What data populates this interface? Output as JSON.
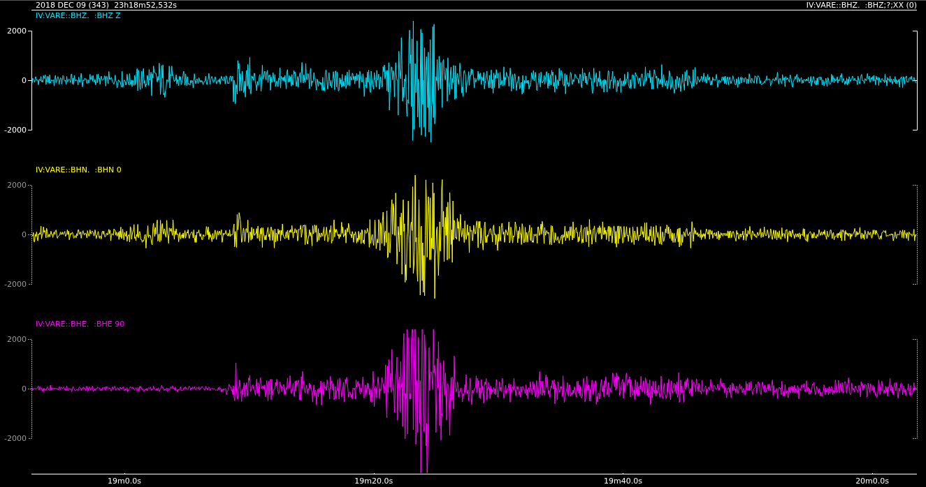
{
  "header": {
    "date_time": "2018 DEC 09 (343)  23h18m52,532s",
    "channel_info": "IV:VARE::BHZ.  :BHZ;?;XX (0)"
  },
  "traces": [
    {
      "label": "IV:VARE::BHZ.  :BHZ Z",
      "color": "#00e6ff",
      "selected": true,
      "y_ticks": [
        "2000",
        "0",
        "-2000"
      ]
    },
    {
      "label": "IV:VARE::BHN.  :BHN 0",
      "color": "#ffff00",
      "selected": false,
      "y_ticks": [
        "2000",
        "0",
        "-2000"
      ]
    },
    {
      "label": "IV:VARE::BHE.  :BHE 90",
      "color": "#ff00ff",
      "selected": false,
      "y_ticks": [
        "2000",
        "0",
        "-2000"
      ]
    }
  ],
  "time_axis": {
    "ticks": [
      "19m0.0s",
      "19m20.0s",
      "19m40.0s",
      "20m0.0s"
    ]
  }
}
